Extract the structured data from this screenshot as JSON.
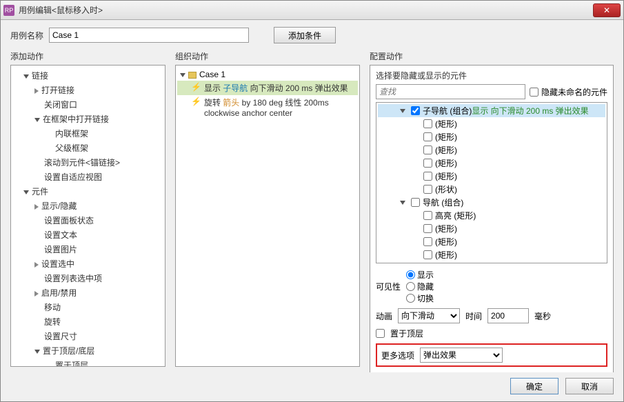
{
  "title": "用例编辑<鼠标移入时>",
  "nameLabel": "用例名称",
  "nameValue": "Case 1",
  "addCondition": "添加条件",
  "cols": {
    "left": "添加动作",
    "mid": "组织动作",
    "right": "配置动作"
  },
  "leftTree": [
    {
      "t": "链接",
      "d": 1,
      "e": "open"
    },
    {
      "t": "打开链接",
      "d": 2,
      "e": "closed"
    },
    {
      "t": "关闭窗口",
      "d": 2,
      "e": "none"
    },
    {
      "t": "在框架中打开链接",
      "d": 2,
      "e": "open"
    },
    {
      "t": "内联框架",
      "d": 3,
      "e": "none"
    },
    {
      "t": "父级框架",
      "d": 3,
      "e": "none"
    },
    {
      "t": "滚动到元件<锚链接>",
      "d": 2,
      "e": "none"
    },
    {
      "t": "设置自适应视图",
      "d": 2,
      "e": "none"
    },
    {
      "t": "元件",
      "d": 1,
      "e": "open"
    },
    {
      "t": "显示/隐藏",
      "d": 2,
      "e": "closed"
    },
    {
      "t": "设置面板状态",
      "d": 2,
      "e": "none"
    },
    {
      "t": "设置文本",
      "d": 2,
      "e": "none"
    },
    {
      "t": "设置图片",
      "d": 2,
      "e": "none"
    },
    {
      "t": "设置选中",
      "d": 2,
      "e": "closed"
    },
    {
      "t": "设置列表选中项",
      "d": 2,
      "e": "none"
    },
    {
      "t": "启用/禁用",
      "d": 2,
      "e": "closed"
    },
    {
      "t": "移动",
      "d": 2,
      "e": "none"
    },
    {
      "t": "旋转",
      "d": 2,
      "e": "none"
    },
    {
      "t": "设置尺寸",
      "d": 2,
      "e": "none"
    },
    {
      "t": "置于顶层/底层",
      "d": 2,
      "e": "open"
    },
    {
      "t": "置于顶层",
      "d": 3,
      "e": "none"
    }
  ],
  "midCase": "Case 1",
  "midActions": [
    {
      "label": "显示",
      "target": "子导航",
      "suffix": "向下滑动 200 ms 弹出效果",
      "sel": true
    },
    {
      "label": "旋转",
      "target": "箭头",
      "suffix": "by 180 deg 线性 200ms clockwise anchor center",
      "sel": false,
      "orange": true
    }
  ],
  "rightHeader": "选择要隐藏或显示的元件",
  "searchPlaceholder": "查找",
  "hideUnnamed": "隐藏未命名的元件",
  "widgets": [
    {
      "d": 2,
      "e": "open",
      "chk": true,
      "name": "子导航 (组合)",
      "extra": "显示 向下滑动 200 ms 弹出效果",
      "sel": true,
      "green": true
    },
    {
      "d": 3,
      "e": "none",
      "chk": false,
      "name": "(矩形)"
    },
    {
      "d": 3,
      "e": "none",
      "chk": false,
      "name": "(矩形)"
    },
    {
      "d": 3,
      "e": "none",
      "chk": false,
      "name": "(矩形)"
    },
    {
      "d": 3,
      "e": "none",
      "chk": false,
      "name": "(矩形)"
    },
    {
      "d": 3,
      "e": "none",
      "chk": false,
      "name": "(矩形)"
    },
    {
      "d": 3,
      "e": "none",
      "chk": false,
      "name": "(形状)"
    },
    {
      "d": 2,
      "e": "open",
      "chk": false,
      "name": "导航 (组合)"
    },
    {
      "d": 3,
      "e": "none",
      "chk": false,
      "name": "高亮 (矩形)"
    },
    {
      "d": 3,
      "e": "none",
      "chk": false,
      "name": "(矩形)"
    },
    {
      "d": 3,
      "e": "none",
      "chk": false,
      "name": "(矩形)"
    },
    {
      "d": 3,
      "e": "none",
      "chk": false,
      "name": "(矩形)"
    }
  ],
  "visibility": {
    "label": "可见性",
    "opts": [
      "显示",
      "隐藏",
      "切换"
    ],
    "sel": 0
  },
  "anim": {
    "label": "动画",
    "value": "向下滑动",
    "timeLabel": "时间",
    "timeVal": "200",
    "unit": "毫秒"
  },
  "bringFront": "置于顶层",
  "more": {
    "label": "更多选项",
    "value": "弹出效果"
  },
  "footer": {
    "ok": "确定",
    "cancel": "取消"
  }
}
